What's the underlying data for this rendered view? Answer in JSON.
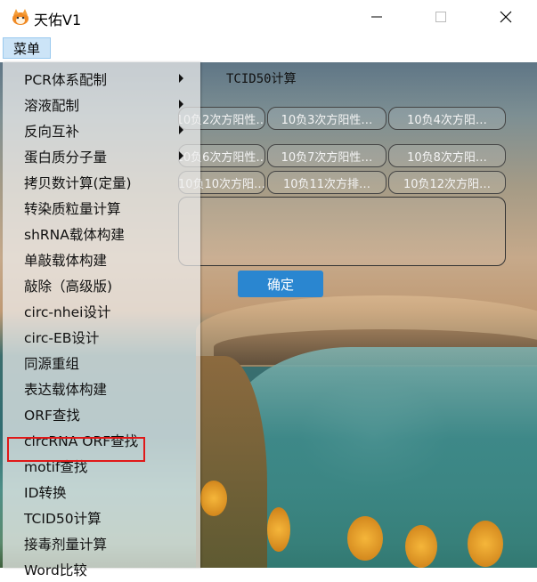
{
  "window": {
    "title": "天佑V1",
    "icon": "fox-app-icon",
    "controls": {
      "minimize": "—",
      "maximize": "□",
      "close": "✕"
    }
  },
  "menubar": {
    "menu_label": "菜单"
  },
  "panel": {
    "title": "TCID50计算",
    "chips_row1": [
      "10负2次方阳性…",
      "10负3次方阳性…",
      "10负4次方阳…"
    ],
    "chips_row2": [
      "10负6次方阳性…",
      "10负7次方阳性…",
      "10负8次方阳…"
    ],
    "chips_row3": [
      "10负10次方阳…",
      "10负11次方排…",
      "10负12次方阳…"
    ],
    "confirm_label": "确定"
  },
  "menu_items": [
    {
      "label": "PCR体系配制",
      "submenu": true
    },
    {
      "label": "溶液配制",
      "submenu": true
    },
    {
      "label": "反向互补",
      "submenu": true
    },
    {
      "label": "蛋白质分子量",
      "submenu": true
    },
    {
      "label": "拷贝数计算(定量)",
      "submenu": false
    },
    {
      "label": "转染质粒量计算",
      "submenu": false
    },
    {
      "label": "shRNA载体构建",
      "submenu": false
    },
    {
      "label": "单敲载体构建",
      "submenu": false
    },
    {
      "label": "敲除（高级版)",
      "submenu": false
    },
    {
      "label": "circ-nhei设计",
      "submenu": false
    },
    {
      "label": "circ-EB设计",
      "submenu": false
    },
    {
      "label": "同源重组",
      "submenu": false
    },
    {
      "label": "表达载体构建",
      "submenu": false
    },
    {
      "label": "ORF查找",
      "submenu": false
    },
    {
      "label": "circRNA ORF查找",
      "submenu": false
    },
    {
      "label": "motif查找",
      "submenu": false
    },
    {
      "label": "ID转换",
      "submenu": false
    },
    {
      "label": "TCID50计算",
      "submenu": false,
      "highlighted": true
    },
    {
      "label": "接毒剂量计算",
      "submenu": false
    },
    {
      "label": "Word比较",
      "submenu": false
    }
  ],
  "colors": {
    "highlight": "#e01818",
    "button": "#2a86d0",
    "menu_active": "#cce4f7"
  }
}
